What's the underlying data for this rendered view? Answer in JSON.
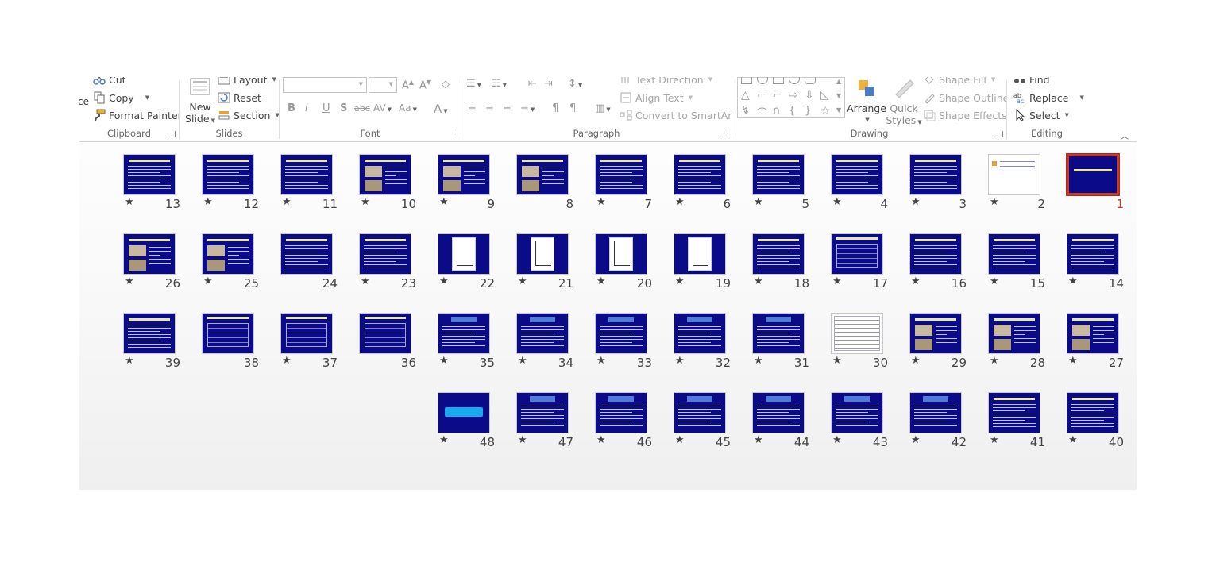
{
  "ribbon": {
    "clipboard": {
      "label": "Clipboard",
      "cut": "Cut",
      "copy": "Copy",
      "format_painter": "Format Painter",
      "paste_partial": "ce"
    },
    "slides": {
      "label": "Slides",
      "new_slide_line1": "New",
      "new_slide_line2": "Slide",
      "layout": "Layout",
      "reset": "Reset",
      "section": "Section"
    },
    "font": {
      "label": "Font"
    },
    "paragraph": {
      "label": "Paragraph",
      "text_direction": "Text Direction",
      "align_text": "Align Text",
      "convert_smartart": "Convert to SmartArt"
    },
    "drawing": {
      "label": "Drawing",
      "arrange": "Arrange",
      "quick_styles_line1": "Quick",
      "quick_styles_line2": "Styles",
      "shape_fill": "Shape Fill",
      "shape_outline": "Shape Outline",
      "shape_effects": "Shape Effects"
    },
    "editing": {
      "label": "Editing",
      "find": "Find",
      "replace": "Replace",
      "select": "Select"
    }
  },
  "slides": [
    {
      "n": "1",
      "kind": "title",
      "selected": true,
      "star": false
    },
    {
      "n": "2",
      "kind": "white",
      "star": true
    },
    {
      "n": "3",
      "kind": "text",
      "star": true
    },
    {
      "n": "4",
      "kind": "text",
      "star": true
    },
    {
      "n": "5",
      "kind": "text",
      "star": true
    },
    {
      "n": "6",
      "kind": "text",
      "star": true
    },
    {
      "n": "7",
      "kind": "text",
      "star": true
    },
    {
      "n": "8",
      "kind": "image",
      "star": false
    },
    {
      "n": "9",
      "kind": "image",
      "star": true
    },
    {
      "n": "10",
      "kind": "image",
      "star": true
    },
    {
      "n": "11",
      "kind": "text",
      "star": true
    },
    {
      "n": "12",
      "kind": "text",
      "star": true
    },
    {
      "n": "13",
      "kind": "text",
      "star": true
    },
    {
      "n": "14",
      "kind": "text",
      "star": true
    },
    {
      "n": "15",
      "kind": "text",
      "star": true
    },
    {
      "n": "16",
      "kind": "text",
      "star": true
    },
    {
      "n": "17",
      "kind": "table",
      "star": true
    },
    {
      "n": "18",
      "kind": "text",
      "star": true
    },
    {
      "n": "19",
      "kind": "chart",
      "star": true
    },
    {
      "n": "20",
      "kind": "chart",
      "star": true
    },
    {
      "n": "21",
      "kind": "chart",
      "star": true
    },
    {
      "n": "22",
      "kind": "chart",
      "star": true
    },
    {
      "n": "23",
      "kind": "text",
      "star": true
    },
    {
      "n": "24",
      "kind": "text",
      "star": false
    },
    {
      "n": "25",
      "kind": "image",
      "star": true
    },
    {
      "n": "26",
      "kind": "image",
      "star": true
    },
    {
      "n": "27",
      "kind": "image",
      "star": true
    },
    {
      "n": "28",
      "kind": "image",
      "star": true
    },
    {
      "n": "29",
      "kind": "image",
      "star": true
    },
    {
      "n": "30",
      "kind": "whitetable",
      "star": true
    },
    {
      "n": "31",
      "kind": "header",
      "star": true
    },
    {
      "n": "32",
      "kind": "header",
      "star": true
    },
    {
      "n": "33",
      "kind": "header",
      "star": true
    },
    {
      "n": "34",
      "kind": "header",
      "star": true
    },
    {
      "n": "35",
      "kind": "header",
      "star": true
    },
    {
      "n": "36",
      "kind": "table",
      "star": false
    },
    {
      "n": "37",
      "kind": "table",
      "star": true
    },
    {
      "n": "38",
      "kind": "table",
      "star": false
    },
    {
      "n": "39",
      "kind": "text",
      "star": true
    },
    {
      "n": "40",
      "kind": "text",
      "star": true
    },
    {
      "n": "41",
      "kind": "text",
      "star": true
    },
    {
      "n": "42",
      "kind": "header",
      "star": true
    },
    {
      "n": "43",
      "kind": "header",
      "star": true
    },
    {
      "n": "44",
      "kind": "header",
      "star": true
    },
    {
      "n": "45",
      "kind": "header",
      "star": true
    },
    {
      "n": "46",
      "kind": "header",
      "star": true
    },
    {
      "n": "47",
      "kind": "header",
      "star": true
    },
    {
      "n": "48",
      "kind": "bigtext",
      "star": true
    }
  ],
  "star_glyph": "★",
  "colors": {
    "slide_bg": "#0b0b8a",
    "selection": "#c0392b"
  }
}
